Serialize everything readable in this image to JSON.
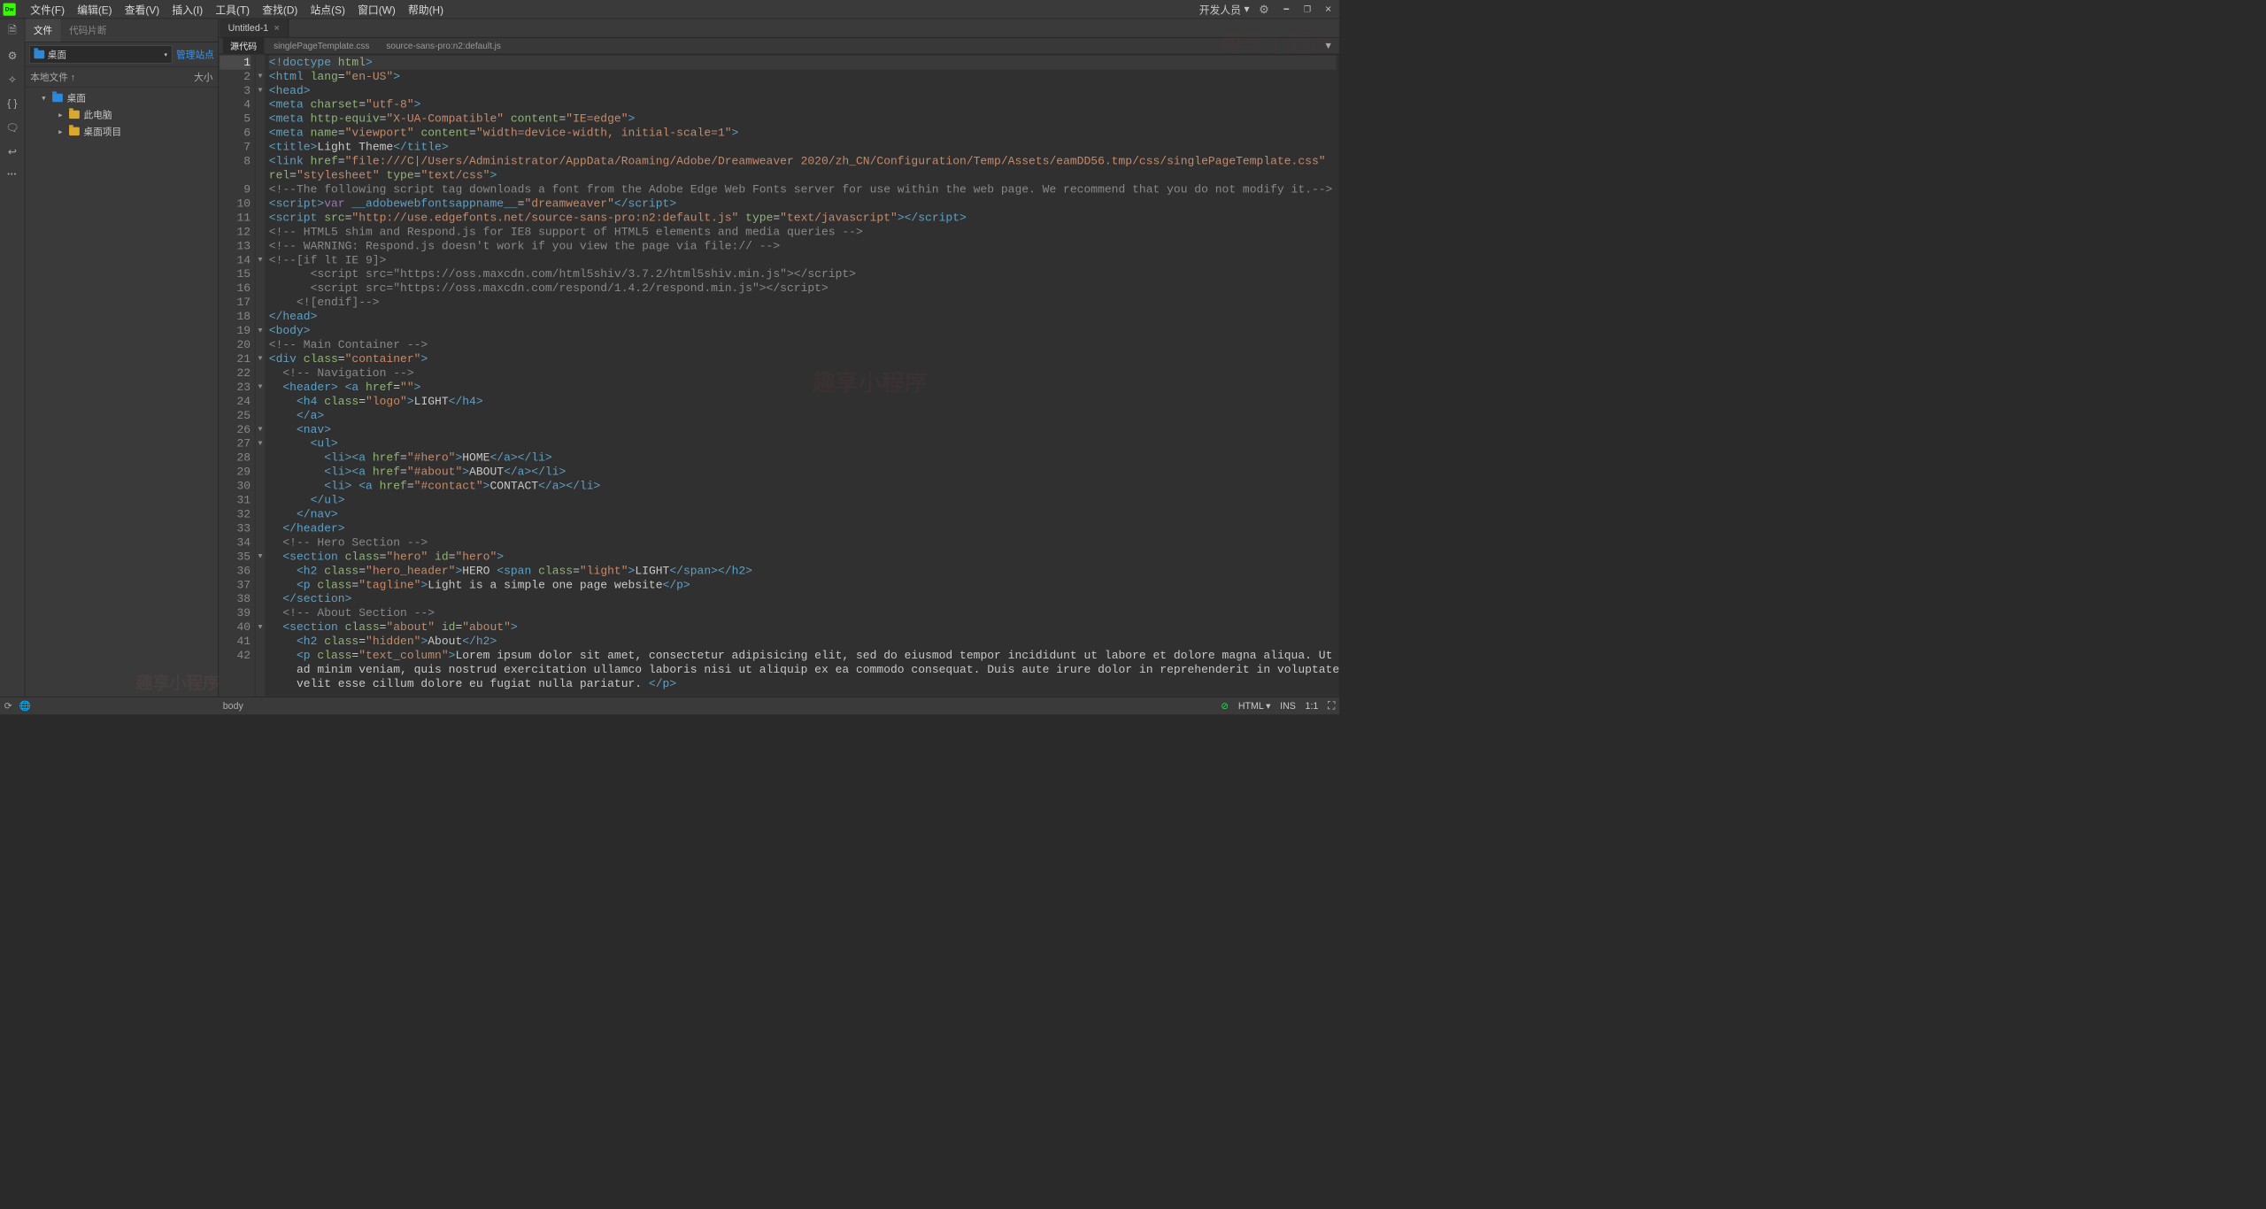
{
  "titlebar": {
    "logo": "Dw",
    "menus": [
      "文件(F)",
      "编辑(E)",
      "查看(V)",
      "插入(I)",
      "工具(T)",
      "查找(D)",
      "站点(S)",
      "窗口(W)",
      "帮助(H)"
    ],
    "workspace_label": "开发人员"
  },
  "side": {
    "tabs": {
      "files": "文件",
      "snippets": "代码片断"
    },
    "dropdown_label": "桌面",
    "manage_link": "管理站点",
    "col_files": "本地文件 ↑",
    "col_size": "大小",
    "tree": {
      "root": "桌面",
      "pc": "此电脑",
      "items": "桌面项目"
    }
  },
  "doc": {
    "tab_title": "Untitled-1",
    "subtab_source": "源代码",
    "subtab_css": "singlePageTemplate.css",
    "subtab_js": "source-sans-pro:n2:default.js"
  },
  "status": {
    "path": "body",
    "lang": "HTML",
    "ins": "INS",
    "pos": "1:1"
  },
  "watermark": "趣享小程序"
}
